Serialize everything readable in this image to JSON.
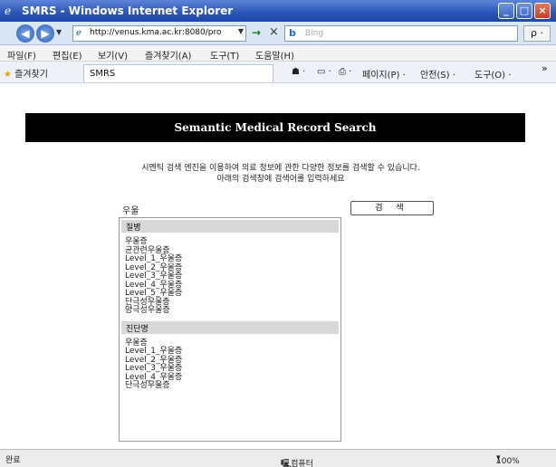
{
  "window": {
    "title": "SMRS - Windows Internet Explorer",
    "controls": [
      "_",
      "□",
      "×"
    ]
  },
  "toolbar": {
    "back": "◀",
    "forward": "▶",
    "url": "http://venus.kma.ac.kr:8080/pro",
    "go": "→",
    "stop": "×",
    "search_engine": "b",
    "search_placeholder": "Bing",
    "search_button": "ρ ·"
  },
  "menu": [
    "파일(F)",
    "편집(E)",
    "보기(V)",
    "즐겨찾기(A)",
    "도구(T)",
    "도움말(H)"
  ],
  "favbar": {
    "favorites": "즐겨찾기",
    "tab_title": "SMRS",
    "tools": [
      "☗ ·",
      "▭ ·",
      "⎙ ·",
      "페이지(P) ·",
      "안전(S) ·",
      "도구(O) ·"
    ],
    "overflow": "»"
  },
  "page": {
    "banner": "Semantic Medical Record Search",
    "intro_line1": "시멘틱 검색 엔진을 이용하여 의료 정보에 관한 다양한 정보를 검색할 수 있습니다.",
    "intro_line2": "아래의 검색창에 검색어를 입력하세요",
    "query": "우울",
    "search_button": "검 색",
    "groups": [
      {
        "header": "질병",
        "items": [
          "우울증",
          "균관련우울증",
          "Level_1_우울증",
          "Level_2_우울증",
          "Level_3_우울증",
          "Level_4_우울증",
          "Level_5_우울증",
          "단극성우울증",
          "양극성우울증"
        ]
      },
      {
        "header": "진단명",
        "items": [
          "우울증",
          "Level_1_우울증",
          "Level_2_우울증",
          "Level_3_우울증",
          "Level_4_우울증",
          "단극성우울증"
        ]
      }
    ]
  },
  "status": {
    "text": "완료",
    "zone": "내 컴퓨터",
    "zoom": "100%"
  }
}
